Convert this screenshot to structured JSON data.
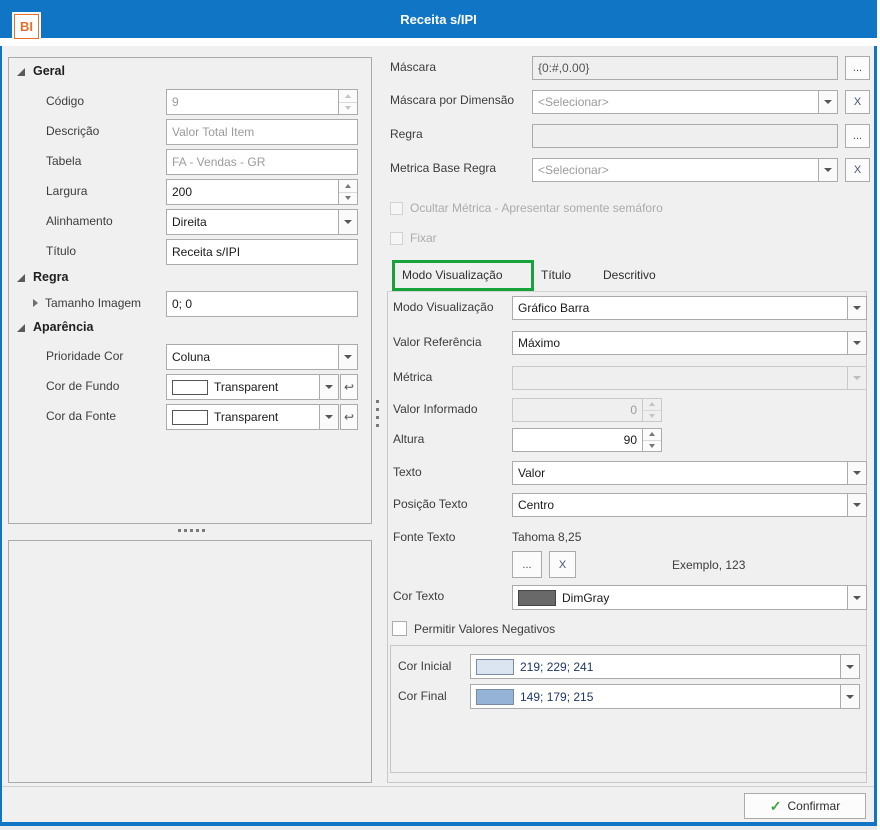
{
  "window": {
    "title": "Receita s/IPI",
    "icon_text": "BI"
  },
  "left": {
    "geral_header": "Geral",
    "codigo_label": "Código",
    "codigo_value": "9",
    "descricao_label": "Descrição",
    "descricao_value": "Valor Total Item",
    "tabela_label": "Tabela",
    "tabela_value": "FA - Vendas - GR",
    "largura_label": "Largura",
    "largura_value": "200",
    "alinhamento_label": "Alinhamento",
    "alinhamento_value": "Direita",
    "titulo_label": "Título",
    "titulo_value": "Receita s/IPI",
    "regra_header": "Regra",
    "tamanho_imagem_label": "Tamanho Imagem",
    "tamanho_imagem_value": "0; 0",
    "aparencia_header": "Aparência",
    "prioridade_cor_label": "Prioridade Cor",
    "prioridade_cor_value": "Coluna",
    "cor_fundo_label": "Cor de Fundo",
    "cor_fundo_value": "Transparent",
    "cor_fonte_label": "Cor da Fonte",
    "cor_fonte_value": "Transparent"
  },
  "right": {
    "mascara_label": "Máscara",
    "mascara_value": "{0:#,0.00}",
    "mascara_dim_label": "Máscara por Dimensão",
    "mascara_dim_value": "<Selecionar>",
    "regra_label": "Regra",
    "regra_value": "",
    "metrica_base_label": "Metrica Base Regra",
    "metrica_base_value": "<Selecionar>",
    "ocultar_checkbox_label": "Ocultar Métrica - Apresentar somente semáforo",
    "fixar_checkbox_label": "Fixar",
    "tabs": [
      "Modo Visualização",
      "Título",
      "Descritivo"
    ],
    "modo_label": "Modo Visualização",
    "modo_value": "Gráfico Barra",
    "valor_ref_label": "Valor Referência",
    "valor_ref_value": "Máximo",
    "metrica_label": "Métrica",
    "metrica_value": "",
    "valor_inf_label": "Valor Informado",
    "valor_inf_value": "0",
    "altura_label": "Altura",
    "altura_value": "90",
    "texto_label": "Texto",
    "texto_value": "Valor",
    "posicao_label": "Posição Texto",
    "posicao_value": "Centro",
    "fonte_label": "Fonte Texto",
    "fonte_value": "Tahoma 8,25",
    "exemplo_text": "Exemplo, 123",
    "cor_texto_label": "Cor Texto",
    "cor_texto_value": "DimGray",
    "permitir_checkbox_label": "Permitir Valores Negativos",
    "cor_inicial_label": "Cor Inicial",
    "cor_inicial_value": "219; 229; 241",
    "cor_final_label": "Cor Final",
    "cor_final_value": "149; 179; 215",
    "ellipsis": "...",
    "clear": "X"
  },
  "footer": {
    "confirm_label": "Confirmar",
    "check_glyph": "✓"
  },
  "colors": {
    "titlebar": "#1075C5",
    "annotation_green": "#18A23B",
    "dim_gray": "#696969",
    "cor_inicial": "#DBE5F1",
    "cor_final": "#95B3D7",
    "transparent_swatch": "#FFFFFF"
  }
}
